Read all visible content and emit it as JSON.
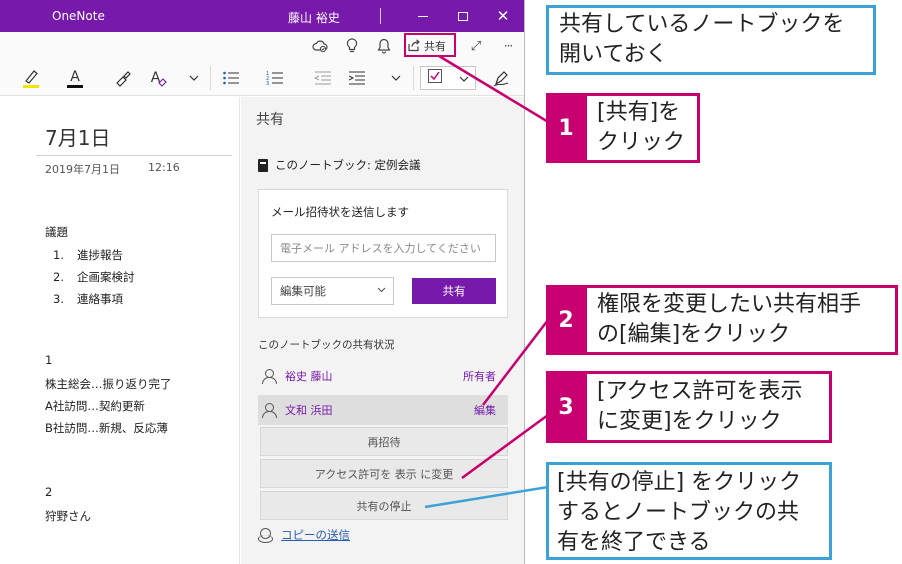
{
  "window": {
    "app_title": "OneNote",
    "user_name": "藤山 裕史",
    "brand_color": "#7719aa",
    "controls": [
      "minimize-icon",
      "maximize-icon",
      "close-icon"
    ],
    "close_glyph": "✕"
  },
  "command_bar": {
    "icons": [
      "sync-status-icon",
      "lightbulb-icon",
      "bell-icon",
      "share-icon",
      "expand-icon",
      "more-icon"
    ],
    "share_label": "共有",
    "more_glyph": "···",
    "expand_glyph": "⤢"
  },
  "ribbon": {
    "tools": [
      "highlighter-icon",
      "font-color-icon",
      "format-painter-icon",
      "clear-format-icon",
      "chevron-down-icon",
      "bullet-list-icon",
      "numbered-list-icon",
      "decrease-indent-icon",
      "increase-indent-icon",
      "chevron-down-icon",
      "todo-tag-icon",
      "chevron-down-icon",
      "pen-icon"
    ],
    "font_color_letter": "A",
    "clear_format_letter": "A",
    "highlight_color": "#f2e500"
  },
  "page": {
    "title": "7月1日",
    "date": "2019年7月1日",
    "time": "12:16",
    "agenda_heading": "議題",
    "agenda_items": [
      {
        "num": "1.",
        "text": "進捗報告"
      },
      {
        "num": "2.",
        "text": "企画案検討"
      },
      {
        "num": "3.",
        "text": "連絡事項"
      }
    ],
    "section1": {
      "num": "1",
      "lines": [
        "株主総会…振り返り完了",
        "A社訪問…契約更新",
        "B社訪問…新規、反応薄"
      ]
    },
    "section2": {
      "num": "2",
      "lines": [
        "狩野さん"
      ]
    }
  },
  "share_pane": {
    "title": "共有",
    "notebook_line": "このノートブック: 定例会議",
    "invite_label": "メール招待状を送信します",
    "email_placeholder": "電子メール アドレスを入力してください",
    "permission_value": "編集可能",
    "share_button": "共有",
    "status_title": "このノートブックの共有状況",
    "members": [
      {
        "name": "裕史 藤山",
        "role": "所有者"
      },
      {
        "name": "文和 浜田",
        "role": "編集"
      }
    ],
    "actions": [
      "再招待",
      "アクセス許可を 表示 に変更",
      "共有の停止"
    ],
    "copy_link": "コピーの送信"
  },
  "callouts": {
    "top": [
      "共有しているノートブックを",
      "開いておく"
    ],
    "step1": {
      "num": "1",
      "lines": [
        "[共有]を",
        "クリック"
      ]
    },
    "step2": {
      "num": "2",
      "lines": [
        "権限を変更したい共有相手",
        "の[編集]をクリック"
      ]
    },
    "step3": {
      "num": "3",
      "lines": [
        "[アクセス許可を表示",
        "に変更]をクリック"
      ]
    },
    "bottom": [
      "[共有の停止] をクリック",
      "するとノートブックの共",
      "有を終了できる"
    ],
    "colors": {
      "blue": "#3aa2d6",
      "pink": "#c8006f"
    }
  }
}
